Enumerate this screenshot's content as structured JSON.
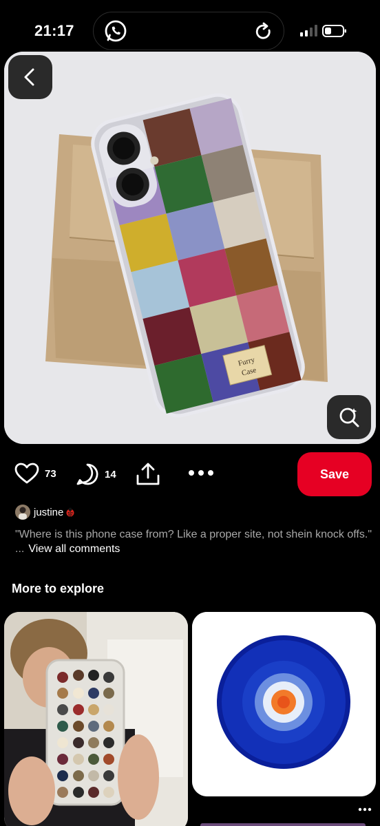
{
  "status_bar": {
    "time": "21:17",
    "icons": [
      "whatsapp-icon",
      "refresh-icon",
      "signal-icon",
      "battery-icon"
    ]
  },
  "pin": {
    "image_label": "Furry Case",
    "likes": "73",
    "comments": "14"
  },
  "actions": {
    "save_label": "Save"
  },
  "comment": {
    "username": "justine",
    "text": "\"Where is this phone case from? Like a proper site, not shein knock offs.\" ...",
    "view_all_label": "View all comments"
  },
  "explore": {
    "title": "More to explore"
  },
  "colors": {
    "save_red": "#e60023",
    "background": "#000000",
    "muted_text": "#a9a9a9"
  }
}
